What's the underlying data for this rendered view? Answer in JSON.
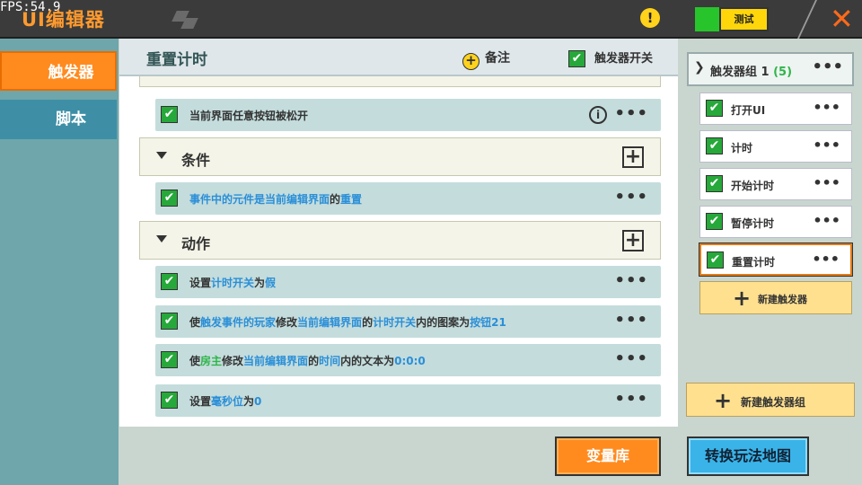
{
  "fps": "FPS:54.9",
  "app_title": "UI编辑器",
  "test_label": "测试",
  "close_glyph": "✕",
  "warn_glyph": "!",
  "tabs": [
    {
      "label": "触发器",
      "active": true
    },
    {
      "label": "脚本",
      "active": false
    }
  ],
  "main": {
    "title": "重置计时",
    "note_label": "备注",
    "trigger_switch_label": "触发器开关",
    "event_row": "当前界面任意按钮被松开",
    "condition_section": "条件",
    "condition_row": {
      "p1": "事件中的元件是当前编辑界面",
      "p2": "的",
      "p3": "重置"
    },
    "action_section": "动作",
    "actions": [
      {
        "a": "设置",
        "b": "计时开关",
        "c": "为",
        "d": "假"
      },
      {
        "a": "使",
        "b": "触发事件的玩家",
        "c": "修改",
        "d": "当前编辑界面",
        "e": "的",
        "f": "计时开关",
        "g": "内的图案为",
        "h": "按钮21"
      },
      {
        "a": "使",
        "b": "房主",
        "c": "修改",
        "d": "当前编辑界面",
        "e": "的",
        "f": "时间",
        "g": "内的文本为",
        "h": "0:0:0"
      },
      {
        "a": "设置",
        "b": "毫秒位",
        "c": "为",
        "d": "0"
      }
    ]
  },
  "right": {
    "group_name": "触发器组 1",
    "group_count": "(5)",
    "items": [
      "打开UI",
      "计时",
      "开始计时",
      "暂停计时",
      "重置计时"
    ],
    "new_trigger": "新建触发器",
    "new_group": "新建触发器组"
  },
  "bottom": {
    "var_lib": "变量库",
    "switch_map": "转换玩法地图"
  },
  "colors": {
    "accent_orange": "#ff8b1f",
    "accent_blue": "#3ab3e8",
    "check_green": "#27a83a",
    "highlight_blue": "#2a8fd8",
    "highlight_green": "#2fb54a"
  }
}
